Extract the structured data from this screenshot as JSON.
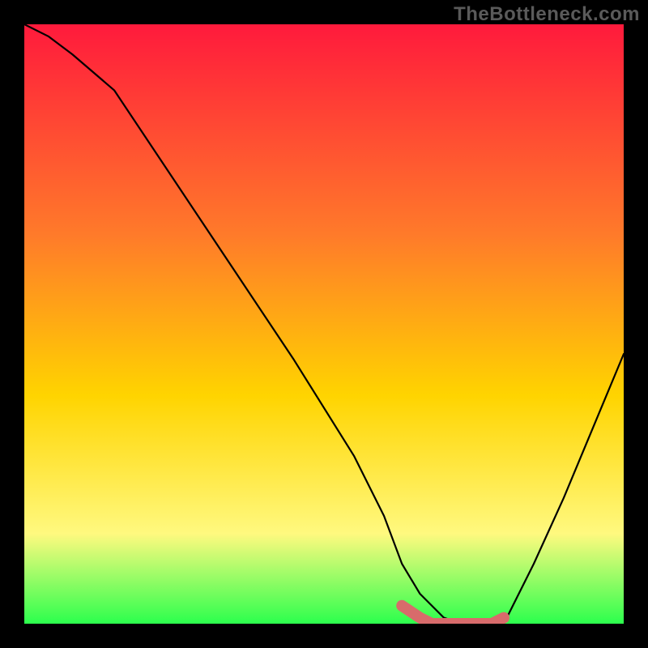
{
  "watermark": "TheBottleneck.com",
  "chart_data": {
    "type": "line",
    "title": "",
    "xlabel": "",
    "ylabel": "",
    "xlim": [
      0,
      100
    ],
    "ylim": [
      0,
      100
    ],
    "grid": false,
    "series": [
      {
        "name": "bottleneck-curve",
        "x": [
          0,
          4,
          8,
          15,
          25,
          35,
          45,
          55,
          60,
          63,
          66,
          70,
          73,
          76,
          80,
          85,
          90,
          95,
          100
        ],
        "values": [
          100,
          98,
          95,
          89,
          74,
          59,
          44,
          28,
          18,
          10,
          5,
          1,
          0,
          0,
          0,
          10,
          21,
          33,
          45
        ]
      }
    ],
    "highlight": {
      "name": "minimum-zone",
      "x": [
        63,
        66,
        68,
        70,
        72,
        74,
        76,
        78,
        80
      ],
      "values": [
        3,
        1,
        0,
        0,
        0,
        0,
        0,
        0,
        1
      ]
    },
    "annotations": []
  },
  "colors": {
    "gradient_top": "#ff1a3c",
    "gradient_mid1": "#ff7a2a",
    "gradient_mid2": "#ffd400",
    "gradient_mid3": "#fff97f",
    "gradient_bottom": "#2cff4d",
    "curve": "#000000",
    "highlight": "#d86b6b",
    "frame": "#000000"
  }
}
